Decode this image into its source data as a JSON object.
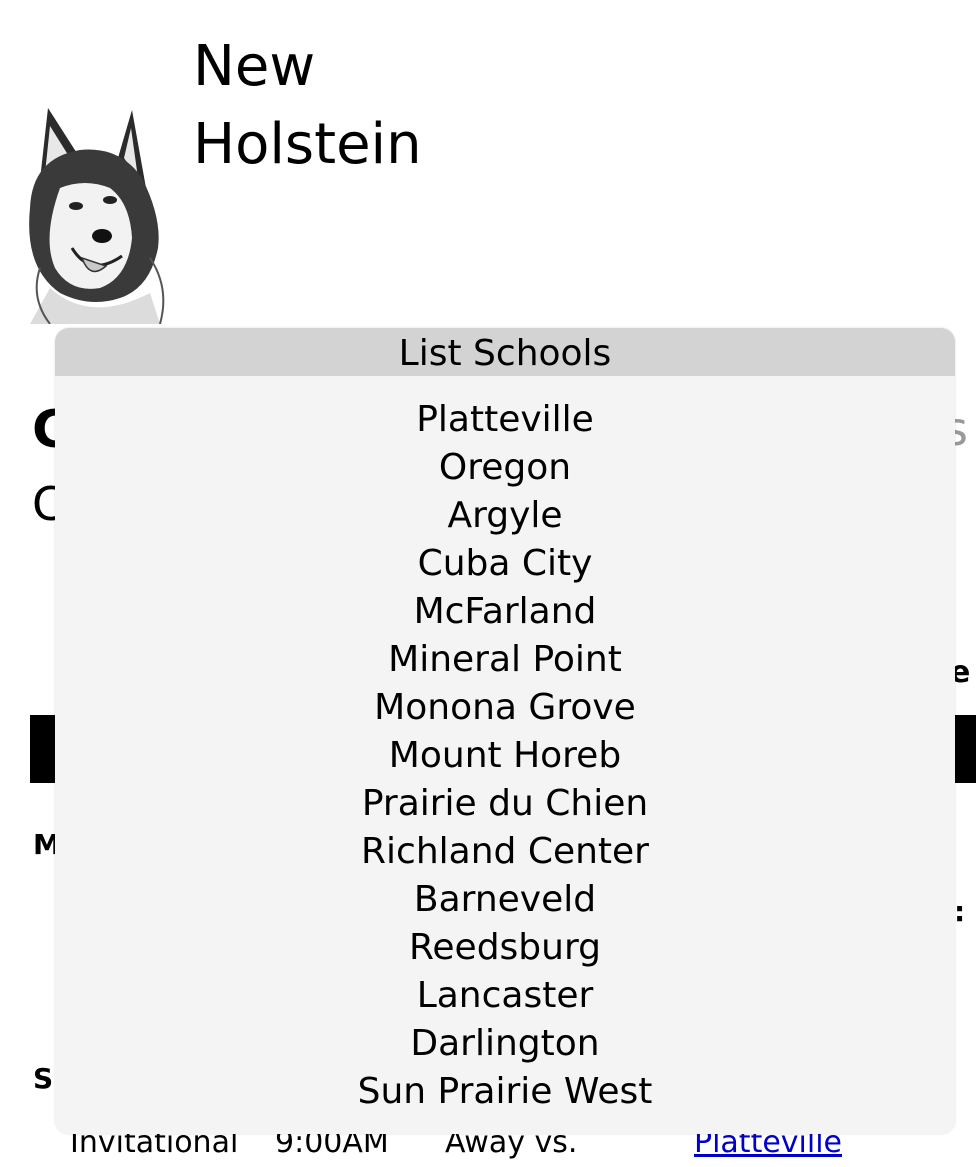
{
  "header": {
    "school_line1": "New",
    "school_line2": "Holstein",
    "logo_icon": "husky-logo-icon"
  },
  "popup": {
    "title": "List Schools",
    "schools": [
      "Platteville",
      "Oregon",
      "Argyle",
      "Cuba City",
      "McFarland",
      "Mineral Point",
      "Monona Grove",
      "Mount Horeb",
      "Prairie du Chien",
      "Richland Center",
      "Barneveld",
      "Reedsburg",
      "Lancaster",
      "Darlington",
      "Sun Prairie West"
    ]
  },
  "background": {
    "h1_fragment": "C",
    "h2_fragment": "C",
    "m_fragment": "M",
    "s_fragment": "S",
    "right_fragment_small": "e",
    "right_fragment_colon": ":",
    "right_fragment_h1": "s"
  },
  "schedule_row": {
    "event": "Invitational",
    "time": "9:00AM",
    "location": "Away vs.",
    "opponent": "Platteville"
  }
}
